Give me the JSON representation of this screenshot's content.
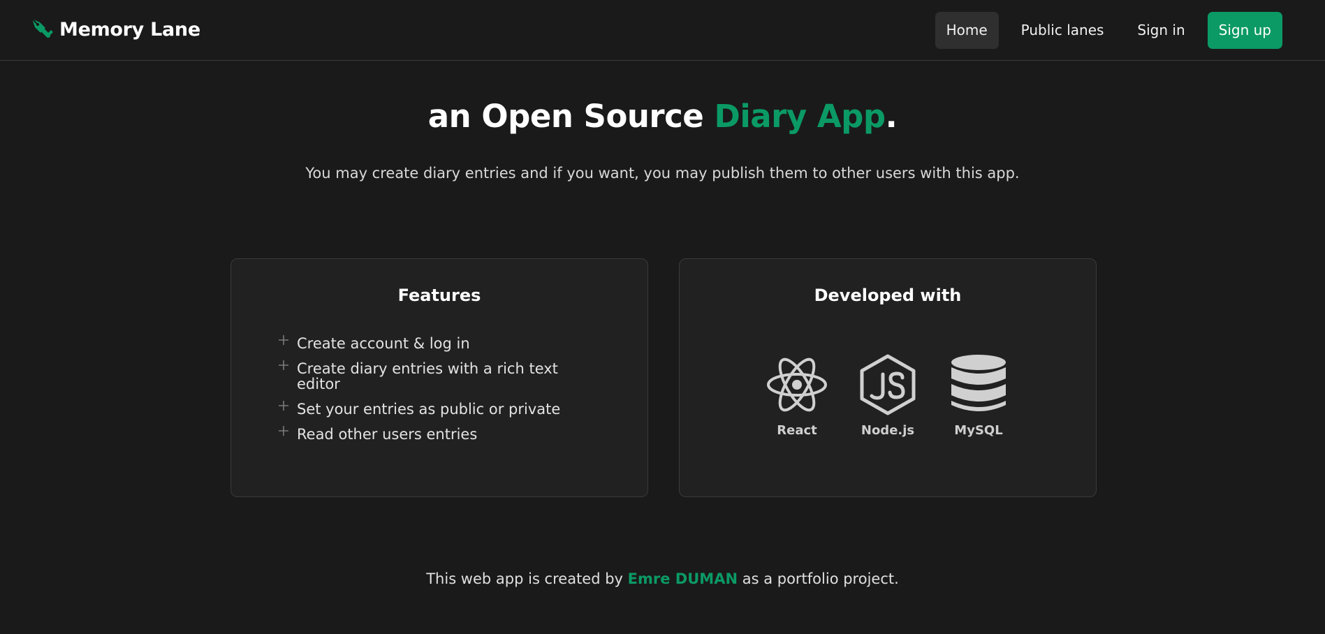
{
  "navbar": {
    "brand": "Memory Lane",
    "brand_icon": "fountain-pen-icon",
    "links": [
      {
        "label": "Home",
        "active": true
      },
      {
        "label": "Public lanes"
      },
      {
        "label": "Sign in"
      },
      {
        "label": "Sign up"
      }
    ]
  },
  "hero": {
    "title_prefix": "an Open Source ",
    "title_accent": "Diary App",
    "title_suffix": ".",
    "subtitle": "You may create diary entries and if you want, you may publish them to other users with this app."
  },
  "features": {
    "title": "Features",
    "items": [
      "Create account & log in",
      "Create diary entries with a rich text editor",
      "Set your entries as public or private",
      "Read other users entries"
    ]
  },
  "tech": {
    "title": "Developed with",
    "items": [
      {
        "label": "React",
        "icon": "react-icon"
      },
      {
        "label": "Node.js",
        "icon": "nodejs-icon"
      },
      {
        "label": "MySQL",
        "icon": "database-icon"
      }
    ]
  },
  "footer": {
    "prefix": "This web app is created by ",
    "author": "Emre DUMAN",
    "suffix": " as a portfolio project."
  },
  "colors": {
    "background": "#1a1a1a",
    "card": "#212121",
    "accent": "#0b9a65",
    "active_nav": "#2f2f2f"
  }
}
